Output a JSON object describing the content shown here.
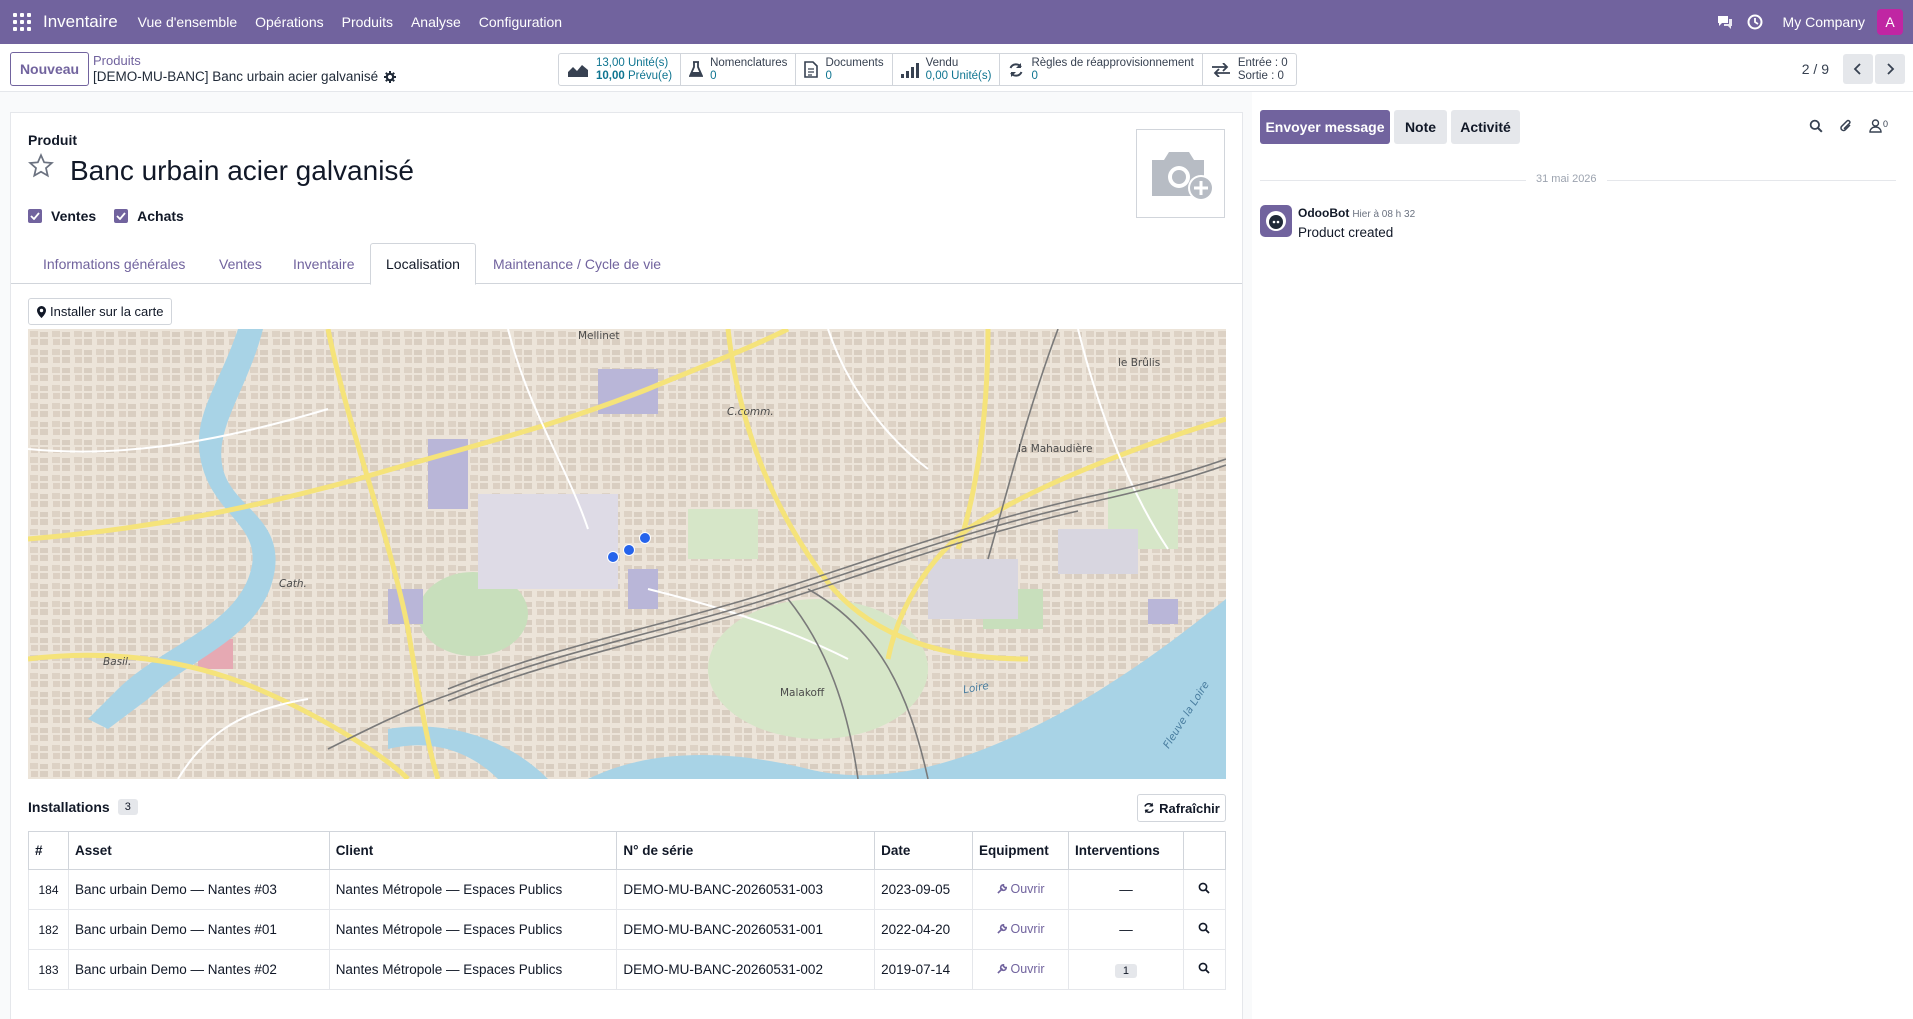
{
  "topbar": {
    "app_name": "Inventaire",
    "nav": [
      "Vue d'ensemble",
      "Opérations",
      "Produits",
      "Analyse",
      "Configuration"
    ],
    "company": "My Company",
    "avatar_letter": "A",
    "icons": [
      "apps-icon",
      "chat-icon",
      "clock-icon"
    ]
  },
  "control": {
    "new_button": "Nouveau",
    "breadcrumb_parent": "Produits",
    "breadcrumb_current": "[DEMO-MU-BANC] Banc urbain acier galvanisé",
    "pager": "2 / 9"
  },
  "smart_buttons": {
    "stock": {
      "on_hand_value": "13,00",
      "on_hand_unit": "Unité(s)",
      "forecast_value": "10,00",
      "forecast_label": "Prévu(e)"
    },
    "bom": {
      "label": "Nomenclatures",
      "value": "0"
    },
    "documents": {
      "label": "Documents",
      "value": "0"
    },
    "sold": {
      "label": "Vendu",
      "value": "0,00 Unité(s)"
    },
    "reorder": {
      "label": "Règles de réapprovisionnement",
      "value": "0"
    },
    "moves": {
      "in": "Entrée : 0",
      "out": "Sortie : 0"
    }
  },
  "form": {
    "product_label": "Produit",
    "product_name": "Banc urbain acier galvanisé",
    "check_sales": "Ventes",
    "check_purchase": "Achats",
    "tabs": [
      "Informations générales",
      "Ventes",
      "Inventaire",
      "Localisation",
      "Maintenance / Cycle de vie"
    ],
    "active_tab": "Localisation",
    "install_button": "Installer sur la carte",
    "map_labels": [
      "Mellinet",
      "C.comm.",
      "le Brûlis",
      "la Mahaudière",
      "Cath.",
      "Basil.",
      "Malakoff",
      "Fleuve la Loire",
      "Loire"
    ],
    "installations_title": "Installations",
    "installations_count": "3",
    "refresh_button": "Rafraîchir"
  },
  "table": {
    "headers": [
      "#",
      "Asset",
      "Client",
      "N° de série",
      "Date",
      "Equipment",
      "Interventions",
      ""
    ],
    "rows": [
      {
        "id": "184",
        "asset": "Banc urbain Demo — Nantes #03",
        "client": "Nantes Métropole — Espaces Publics",
        "serial": "DEMO-MU-BANC-20260531-003",
        "date": "2023-09-05",
        "equipment": "Ouvrir",
        "interventions": "—"
      },
      {
        "id": "182",
        "asset": "Banc urbain Demo — Nantes #01",
        "client": "Nantes Métropole — Espaces Publics",
        "serial": "DEMO-MU-BANC-20260531-001",
        "date": "2022-04-20",
        "equipment": "Ouvrir",
        "interventions": "—"
      },
      {
        "id": "183",
        "asset": "Banc urbain Demo — Nantes #02",
        "client": "Nantes Métropole — Espaces Publics",
        "serial": "DEMO-MU-BANC-20260531-002",
        "date": "2019-07-14",
        "equipment": "Ouvrir",
        "interventions": "1"
      }
    ]
  },
  "chatter": {
    "send": "Envoyer message",
    "note": "Note",
    "activity": "Activité",
    "followers": "0",
    "date": "31 mai 2026",
    "author": "OdooBot",
    "time": "Hier à 08 h 32",
    "body": "Product created"
  },
  "colors": {
    "brand": "#71639e",
    "marker": "#2563eb",
    "water": "#a8d3e6",
    "park": "#c8dfbc"
  }
}
